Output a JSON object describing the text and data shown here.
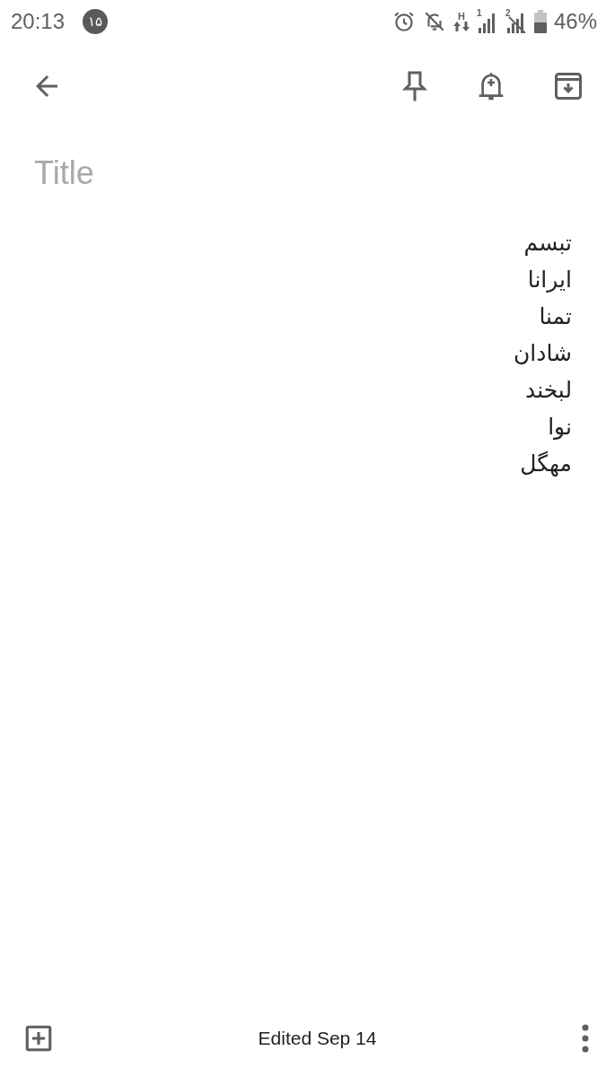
{
  "status_bar": {
    "time": "20:13",
    "notification_badge": "۱۵",
    "network_type": "H",
    "sim_1": "1",
    "sim_2": "2",
    "battery": "46%"
  },
  "note": {
    "title": {
      "placeholder": "Title"
    },
    "lines": [
      "تبسم",
      "ایرانا",
      "تمنا",
      "شادان",
      "لبخند",
      "نوا",
      "مهگل"
    ]
  },
  "footer": {
    "edited": "Edited Sep 14"
  }
}
